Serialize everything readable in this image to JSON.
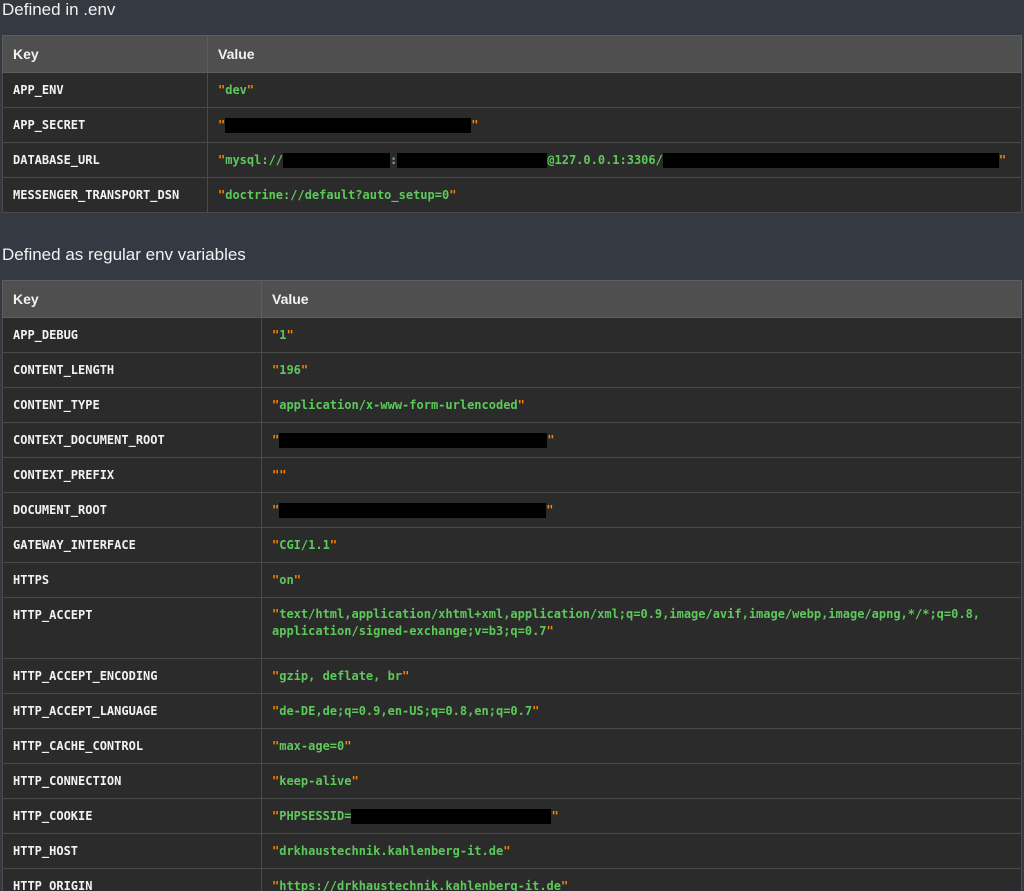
{
  "sections": [
    {
      "title": "Defined in .env",
      "header": {
        "key": "Key",
        "value": "Value"
      },
      "rows": [
        {
          "key": "APP_ENV",
          "value": "dev"
        },
        {
          "key": "APP_SECRET",
          "value": "[redacted]"
        },
        {
          "key": "DATABASE_URL",
          "value_prefix": "mysql://",
          "value_sep": ":",
          "value_host": "@127.0.0.1:3306/"
        },
        {
          "key": "MESSENGER_TRANSPORT_DSN",
          "value": "doctrine://default?auto_setup=0"
        }
      ]
    },
    {
      "title": "Defined as regular env variables",
      "header": {
        "key": "Key",
        "value": "Value"
      },
      "rows": [
        {
          "key": "APP_DEBUG",
          "value": "1"
        },
        {
          "key": "CONTENT_LENGTH",
          "value": "196"
        },
        {
          "key": "CONTENT_TYPE",
          "value": "application/x-www-form-urlencoded"
        },
        {
          "key": "CONTEXT_DOCUMENT_ROOT",
          "value": "[redacted]"
        },
        {
          "key": "CONTEXT_PREFIX",
          "value": ""
        },
        {
          "key": "DOCUMENT_ROOT",
          "value": "[redacted]"
        },
        {
          "key": "GATEWAY_INTERFACE",
          "value": "CGI/1.1"
        },
        {
          "key": "HTTPS",
          "value": "on"
        },
        {
          "key": "HTTP_ACCEPT",
          "value_line1": "text/html,application/xhtml+xml,application/xml;q=0.9,image/avif,image/webp,image/apng,*/*;q=0.8,",
          "value_line2": "application/signed-exchange;v=b3;q=0.7"
        },
        {
          "key": "HTTP_ACCEPT_ENCODING",
          "value": "gzip, deflate, br"
        },
        {
          "key": "HTTP_ACCEPT_LANGUAGE",
          "value": "de-DE,de;q=0.9,en-US;q=0.8,en;q=0.7"
        },
        {
          "key": "HTTP_CACHE_CONTROL",
          "value": "max-age=0"
        },
        {
          "key": "HTTP_CONNECTION",
          "value": "keep-alive"
        },
        {
          "key": "HTTP_COOKIE",
          "value_prefix": "PHPSESSID="
        },
        {
          "key": "HTTP_HOST",
          "value": "drkhaustechnik.kahlenberg-it.de"
        },
        {
          "key": "HTTP_ORIGIN",
          "value": "https://drkhaustechnik.kahlenberg-it.de"
        }
      ]
    }
  ],
  "colors": {
    "page_bg": "#353941",
    "header_bg": "#4f4f4f",
    "row_bg": "#2b2b2b",
    "value_text": "#5ec95b",
    "quote": "#ff8400",
    "redaction": "#000000"
  }
}
